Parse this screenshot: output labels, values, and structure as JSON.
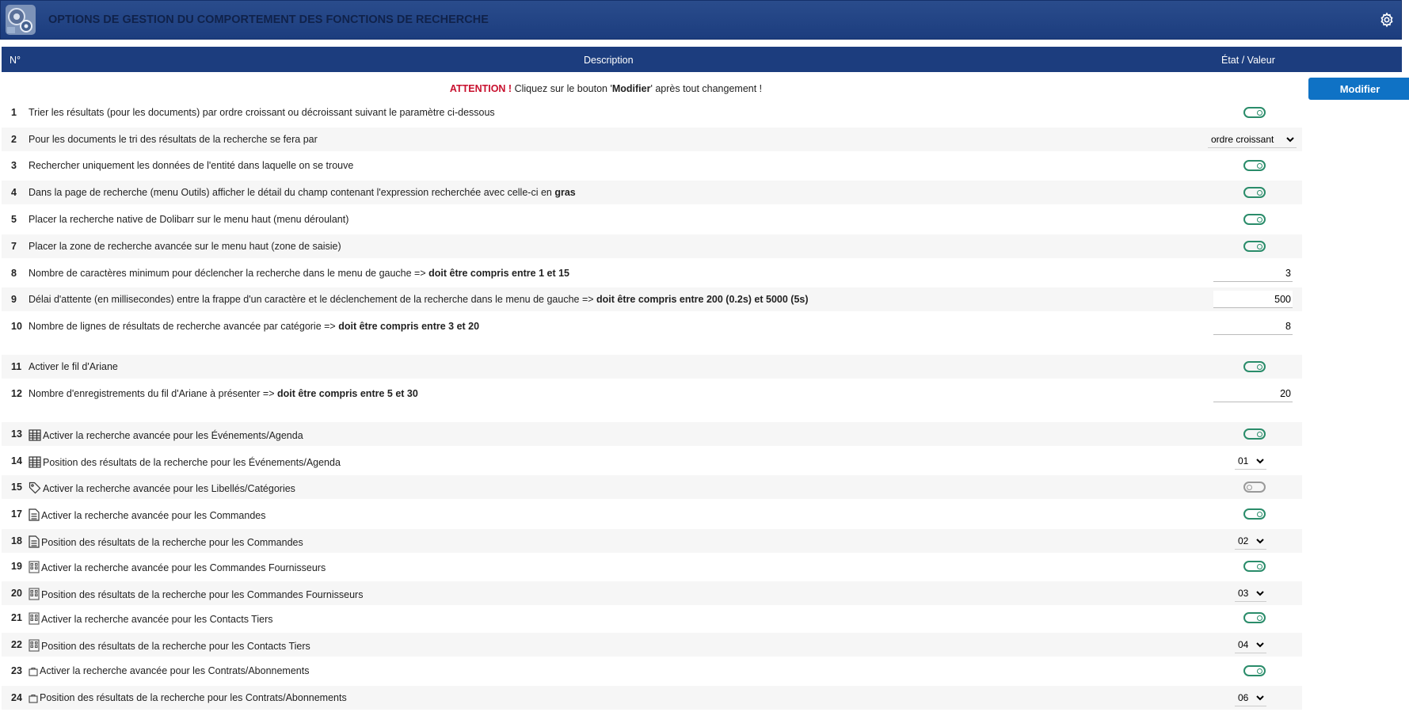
{
  "header": {
    "title": "OPTIONS DE GESTION DU COMPORTEMENT DES FONCTIONS DE RECHERCHE"
  },
  "table": {
    "col_num": "N°",
    "col_desc": "Description",
    "col_state": "État / Valeur"
  },
  "attention": {
    "label": "ATTENTION !",
    "text_before": " Cliquez sur le bouton '",
    "button_word": "Modifier",
    "text_after": "' après tout changement !"
  },
  "modify_button": "Modifier",
  "rows": [
    {
      "num": "1",
      "text": "Trier les résultats (pour les documents) par ordre croissant ou décroissant suivant le paramètre ci-dessous",
      "bold": "",
      "control": "toggle",
      "on": true
    },
    {
      "num": "2",
      "text": "Pour les documents le tri des résultats de la recherche se fera par",
      "bold": "",
      "control": "select",
      "value": "ordre croissant"
    },
    {
      "num": "3",
      "text": "Rechercher uniquement les données de l'entité dans laquelle on se trouve",
      "bold": "",
      "control": "toggle",
      "on": true
    },
    {
      "num": "4",
      "text": "Dans la page de recherche (menu Outils) afficher le détail du champ contenant l'expression recherchée avec celle-ci en ",
      "bold": "gras",
      "control": "toggle",
      "on": true
    },
    {
      "num": "5",
      "text": "Placer la recherche native de Dolibarr sur le menu haut (menu déroulant)",
      "bold": "",
      "control": "toggle",
      "on": true
    },
    {
      "num": "7",
      "text": "Placer la zone de recherche avancée sur le menu haut (zone de saisie)",
      "bold": "",
      "control": "toggle",
      "on": true
    },
    {
      "num": "8",
      "text": "Nombre de caractères minimum pour déclencher la recherche dans le menu de gauche => ",
      "bold": "doit être compris entre 1 et 15",
      "control": "input",
      "value": "3"
    },
    {
      "num": "9",
      "text": "Délai d'attente (en millisecondes) entre la frappe d'un caractère et le déclenchement de la recherche dans le menu de gauche => ",
      "bold": "doit être compris entre 200 (0.2s) et 5000 (5s)",
      "control": "input",
      "value": "500"
    },
    {
      "num": "10",
      "text": "Nombre de lignes de résultats de recherche avancée par catégorie => ",
      "bold": "doit être compris entre 3 et 20",
      "control": "input",
      "value": "8"
    },
    {
      "num": "11",
      "text": "Activer le fil d'Ariane",
      "bold": "",
      "control": "toggle",
      "on": true
    },
    {
      "num": "12",
      "text": "Nombre d'enregistrements du fil d'Ariane à présenter => ",
      "bold": "doit être compris entre 5 et 30",
      "control": "input",
      "value": "20"
    },
    {
      "num": "13",
      "icon": "calendar-icon",
      "text": "Activer la recherche avancée pour les Événements/Agenda",
      "bold": "",
      "control": "toggle",
      "on": true
    },
    {
      "num": "14",
      "icon": "calendar-icon",
      "text": "Position des résultats de la recherche pour les Événements/Agenda",
      "bold": "",
      "control": "smallselect",
      "value": "01"
    },
    {
      "num": "15",
      "icon": "tag-icon",
      "text": "Activer la recherche avancée pour les Libellés/Catégories",
      "bold": "",
      "control": "toggle",
      "on": false
    },
    {
      "num": "17",
      "icon": "document-icon",
      "text": "Activer la recherche avancée pour les Commandes",
      "bold": "",
      "control": "toggle",
      "on": true
    },
    {
      "num": "18",
      "icon": "document-icon",
      "text": "Position des résultats de la recherche pour les Commandes",
      "bold": "",
      "control": "smallselect",
      "value": "02"
    },
    {
      "num": "19",
      "icon": "building-icon",
      "text": "Activer la recherche avancée pour les Commandes Fournisseurs",
      "bold": "",
      "control": "toggle",
      "on": true
    },
    {
      "num": "20",
      "icon": "building-icon",
      "text": "Position des résultats de la recherche pour les Commandes Fournisseurs",
      "bold": "",
      "control": "smallselect",
      "value": "03"
    },
    {
      "num": "21",
      "icon": "building-icon",
      "text": "Activer la recherche avancée pour les Contacts Tiers",
      "bold": "",
      "control": "toggle",
      "on": true
    },
    {
      "num": "22",
      "icon": "building-icon",
      "text": "Position des résultats de la recherche pour les Contacts Tiers",
      "bold": "",
      "control": "smallselect",
      "value": "04"
    },
    {
      "num": "23",
      "icon": "briefcase-icon",
      "text": "Activer la recherche avancée pour les Contrats/Abonnements",
      "bold": "",
      "control": "toggle",
      "on": true
    },
    {
      "num": "24",
      "icon": "briefcase-icon",
      "text": "Position des résultats de la recherche pour les Contrats/Abonnements",
      "bold": "",
      "control": "smallselect",
      "value": "06"
    }
  ]
}
